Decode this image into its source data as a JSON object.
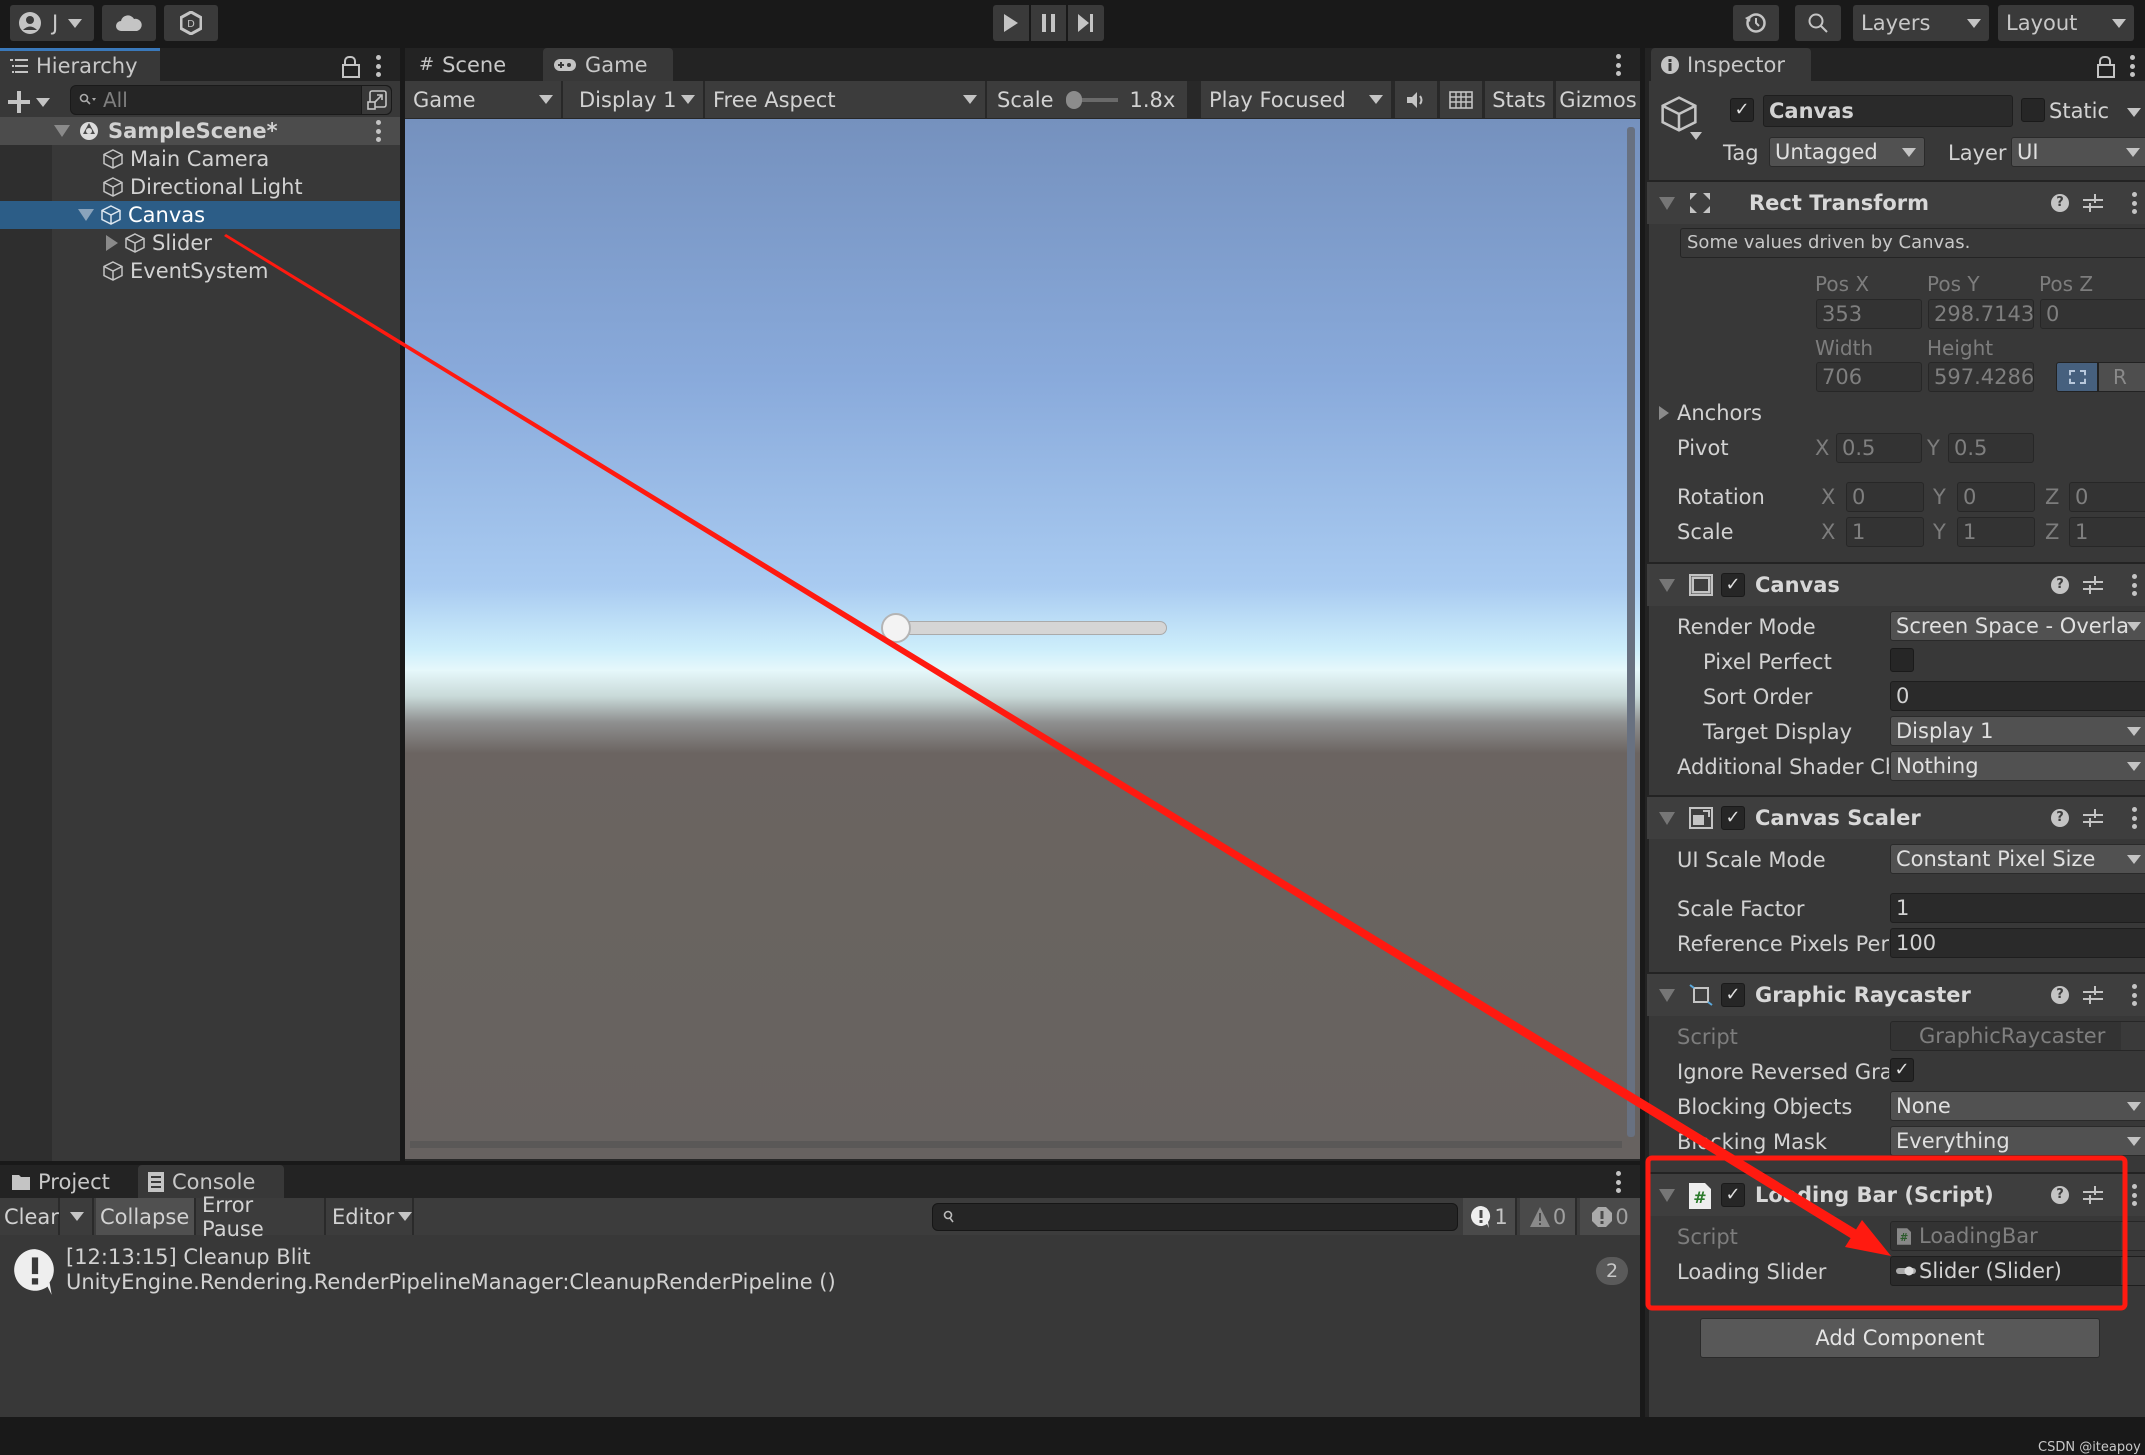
{
  "topbar": {
    "account_label": "J",
    "layers_label": "Layers",
    "layout_label": "Layout"
  },
  "hierarchy": {
    "tab_label": "Hierarchy",
    "search_placeholder": "All",
    "scene_name": "SampleScene*",
    "items": [
      {
        "label": "Main Camera"
      },
      {
        "label": "Directional Light"
      },
      {
        "label": "Canvas",
        "selected": true
      },
      {
        "label": "Slider"
      },
      {
        "label": "EventSystem"
      }
    ]
  },
  "game": {
    "tabs": [
      {
        "label": "Scene"
      },
      {
        "label": "Game"
      }
    ],
    "toolbar": {
      "mode": "Game",
      "display": "Display 1",
      "aspect": "Free Aspect",
      "scale_label": "Scale",
      "scale_value": "1.8x",
      "play_mode": "Play Focused",
      "stats": "Stats",
      "gizmos": "Gizmos"
    },
    "slider_value": 0.0
  },
  "console": {
    "tabs": [
      {
        "label": "Project"
      },
      {
        "label": "Console"
      }
    ],
    "toolbar": {
      "clear": "Clear",
      "collapse": "Collapse",
      "error_pause": "Error Pause",
      "editor": "Editor",
      "log_count": "1",
      "warning_count": "0",
      "error_count": "0"
    },
    "entries": [
      {
        "line1": "[12:13:15] Cleanup Blit",
        "line2": "UnityEngine.Rendering.RenderPipelineManager:CleanupRenderPipeline ()",
        "count": "2"
      }
    ]
  },
  "inspector": {
    "tab_label": "Inspector",
    "object_name": "Canvas",
    "static_label": "Static",
    "tag_label": "Tag",
    "tag_value": "Untagged",
    "layer_label": "Layer",
    "layer_value": "UI",
    "rect_transform": {
      "title": "Rect Transform",
      "note": "Some values driven by Canvas.",
      "pos_x_label": "Pos X",
      "pos_x": "353",
      "pos_y_label": "Pos Y",
      "pos_y": "298.7143",
      "pos_z_label": "Pos Z",
      "pos_z": "0",
      "width_label": "Width",
      "width": "706",
      "height_label": "Height",
      "height": "597.4286",
      "r_button": "R",
      "anchors_label": "Anchors",
      "pivot_label": "Pivot",
      "pivot_x": "0.5",
      "pivot_y": "0.5",
      "rotation_label": "Rotation",
      "rot_x": "0",
      "rot_y": "0",
      "rot_z": "0",
      "scale_label": "Scale",
      "scale_x": "1",
      "scale_y": "1",
      "scale_z": "1"
    },
    "canvas": {
      "title": "Canvas",
      "render_mode_label": "Render Mode",
      "render_mode": "Screen Space - Overla",
      "pixel_perfect_label": "Pixel Perfect",
      "sort_order_label": "Sort Order",
      "sort_order": "0",
      "target_display_label": "Target Display",
      "target_display": "Display 1",
      "shader_label": "Additional Shader Cha",
      "shader_value": "Nothing"
    },
    "canvas_scaler": {
      "title": "Canvas Scaler",
      "ui_scale_mode_label": "UI Scale Mode",
      "ui_scale_mode": "Constant Pixel Size",
      "scale_factor_label": "Scale Factor",
      "scale_factor": "1",
      "ref_pixels_label": "Reference Pixels Per U",
      "ref_pixels": "100"
    },
    "graphic_raycaster": {
      "title": "Graphic Raycaster",
      "script_label": "Script",
      "script_value": "GraphicRaycaster",
      "ignore_reversed_label": "Ignore Reversed Grap",
      "blocking_objects_label": "Blocking Objects",
      "blocking_objects": "None",
      "blocking_mask_label": "Blocking Mask",
      "blocking_mask": "Everything"
    },
    "loading_bar": {
      "title": "Loading Bar (Script)",
      "script_label": "Script",
      "script_value": "LoadingBar",
      "slider_label": "Loading Slider",
      "slider_value": "Slider (Slider)"
    },
    "add_component": "Add Component"
  },
  "watermark": "CSDN @iteapoy",
  "annotation_color": "#ff1a10"
}
